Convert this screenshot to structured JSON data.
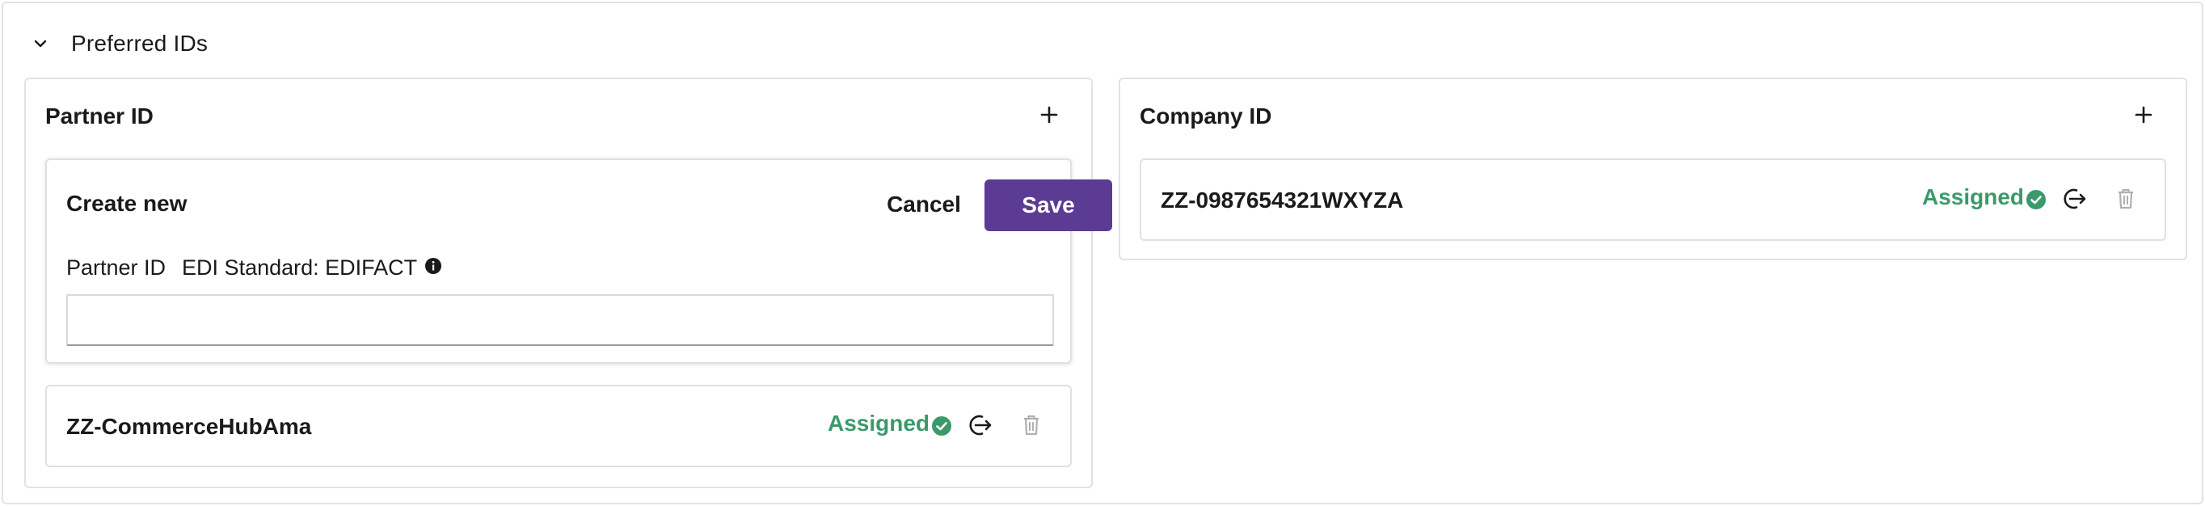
{
  "section": {
    "title": "Preferred IDs"
  },
  "partner": {
    "title": "Partner ID",
    "create": {
      "title": "Create new",
      "cancel_label": "Cancel",
      "save_label": "Save",
      "field_label": "Partner ID",
      "edi_label": "EDI Standard: EDIFACT",
      "input_value": ""
    },
    "items": [
      {
        "id": "ZZ-CommerceHubAma",
        "status": "Assigned"
      }
    ]
  },
  "company": {
    "title": "Company ID",
    "items": [
      {
        "id": "ZZ-0987654321WXYZA",
        "status": "Assigned"
      }
    ]
  },
  "colors": {
    "accent": "#5b3b94",
    "status_green": "#3a9a6a",
    "border": "#e2e2e2"
  },
  "icons": [
    "chevron-down-icon",
    "plus-icon",
    "info-icon",
    "check-circle-icon",
    "unassign-icon",
    "trash-icon"
  ]
}
